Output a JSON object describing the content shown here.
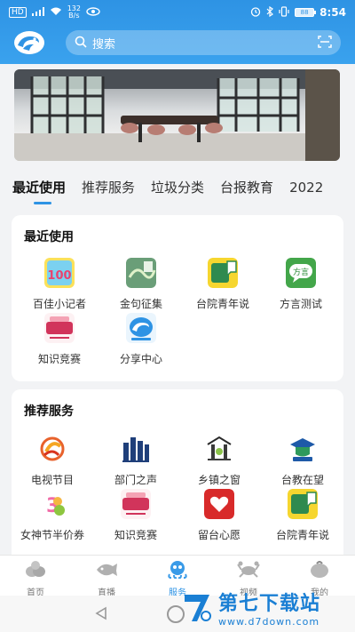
{
  "status_bar": {
    "network": "HD",
    "signal": "4G",
    "speed_value": "132",
    "speed_unit": "B/s",
    "battery": "88",
    "time": "8:54"
  },
  "header": {
    "search_placeholder": "搜索",
    "brand_color": "#2e93e4"
  },
  "tabs": [
    {
      "label": "最近使用",
      "active": true
    },
    {
      "label": "推荐服务",
      "active": false
    },
    {
      "label": "垃圾分类",
      "active": false
    },
    {
      "label": "台报教育",
      "active": false
    },
    {
      "label": "2022",
      "active": false
    }
  ],
  "recent": {
    "title": "最近使用",
    "items": [
      {
        "label": "百佳小记者",
        "icon": "baijia-100-icon"
      },
      {
        "label": "金句征集",
        "icon": "jinju-icon"
      },
      {
        "label": "台院青年说",
        "icon": "qingnianshuo-icon"
      },
      {
        "label": "方言测试",
        "icon": "fangyan-icon"
      },
      {
        "label": "知识竞赛",
        "icon": "quiz-icon"
      },
      {
        "label": "分享中心",
        "icon": "share-center-icon"
      }
    ]
  },
  "recommended": {
    "title": "推荐服务",
    "items": [
      {
        "label": "电视节目",
        "icon": "tv-program-icon"
      },
      {
        "label": "部门之声",
        "icon": "department-icon"
      },
      {
        "label": "乡镇之窗",
        "icon": "township-icon"
      },
      {
        "label": "台教在望",
        "icon": "education-icon"
      },
      {
        "label": "女神节半价券",
        "icon": "coupon-icon"
      },
      {
        "label": "知识竞赛",
        "icon": "quiz-icon"
      },
      {
        "label": "留台心愿",
        "icon": "wish-icon"
      },
      {
        "label": "台院青年说",
        "icon": "qingnianshuo-icon"
      }
    ]
  },
  "tabbar": [
    {
      "label": "首页",
      "icon": "home-icon",
      "active": false
    },
    {
      "label": "直播",
      "icon": "live-icon",
      "active": false
    },
    {
      "label": "服务",
      "icon": "service-icon",
      "active": true
    },
    {
      "label": "视频",
      "icon": "video-icon",
      "active": false
    },
    {
      "label": "我的",
      "icon": "profile-icon",
      "active": false
    }
  ],
  "watermark": {
    "title": "第七下载站",
    "url": "www.d7down.com"
  }
}
